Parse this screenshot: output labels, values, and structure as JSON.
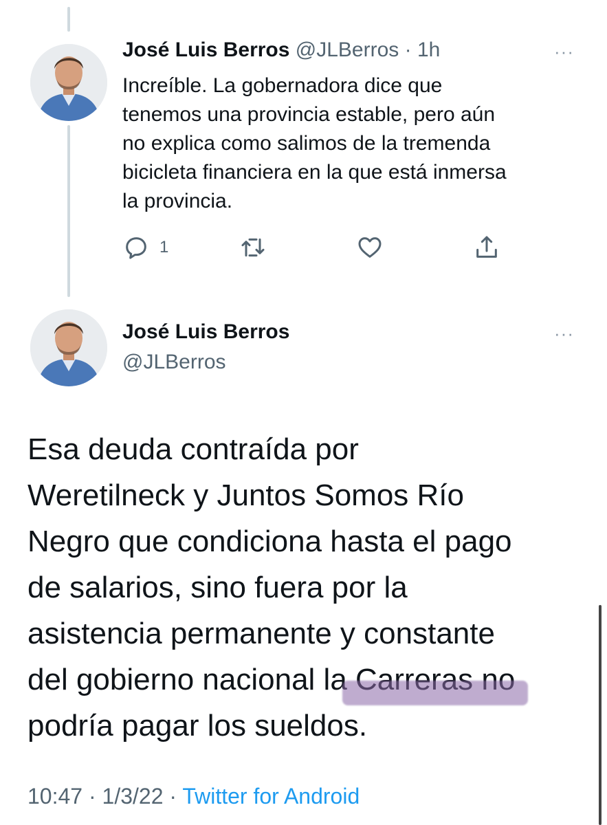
{
  "tweet1": {
    "name": "José Luis Berros",
    "handle": "@JLBerros",
    "separator": " · ",
    "time": "1h",
    "more": "···",
    "text": "Increíble. La gobernadora dice que\ntenemos una provincia estable, pero aún\nno explica como salimos de la tremenda\nbicicleta financiera en la que está inmersa\nla provincia.",
    "reply_count": "1",
    "icons": [
      "reply-icon",
      "retweet-icon",
      "like-icon",
      "share-icon"
    ]
  },
  "tweet2": {
    "name": "José Luis Berros",
    "handle": "@JLBerros",
    "more": "···",
    "text": "Esa deuda contraída por\nWeretilneck y Juntos Somos Río\nNegro que condiciona hasta el pago\nde salarios, sino fuera por la\nasistencia permanente y constante\ndel gobierno nacional la Carreras no\npodría pagar los sueldos.",
    "time": "10:47",
    "sep1": " · ",
    "date": "1/3/22",
    "sep2": " · ",
    "source": "Twitter for Android"
  },
  "colors": {
    "text": "#0f1419",
    "muted": "#536471",
    "link": "#1d9bf0",
    "thread_line": "#cfd9de",
    "highlight": "#8b6aa8"
  }
}
